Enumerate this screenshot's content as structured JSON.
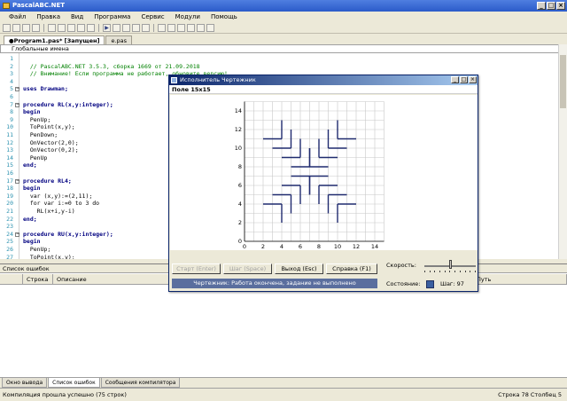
{
  "app": {
    "title": "PascalABC.NET"
  },
  "menu": [
    "Файл",
    "Правка",
    "Вид",
    "Программа",
    "Сервис",
    "Модули",
    "Помощь"
  ],
  "tabs": [
    {
      "label": "●Program1.pas* [Запущен]",
      "active": true
    },
    {
      "label": "e.pas",
      "active": false
    }
  ],
  "scope": {
    "label": "Глобальные имена"
  },
  "editor": {
    "line_numbers": [
      "1",
      "2",
      "3",
      "4",
      "5",
      "6",
      "7",
      "8",
      "9",
      "10",
      "11",
      "12",
      "13",
      "14",
      "15",
      "16",
      "17",
      "18",
      "19",
      "20",
      "21",
      "22",
      "23",
      "24",
      "25",
      "26",
      "27"
    ],
    "lines": [
      {
        "text": "",
        "type": "plain"
      },
      {
        "text": "  // PascalABC.NET 3.5.3, сборка 1669 от 21.09.2018",
        "type": "comment"
      },
      {
        "text": "  // Внимание! Если программа не работает, обновите версию!",
        "type": "comment"
      },
      {
        "text": "",
        "type": "plain"
      },
      {
        "text": "uses Drawman;",
        "type": "kw"
      },
      {
        "text": "",
        "type": "plain"
      },
      {
        "text": "procedure RL(x,y:integer);",
        "type": "kw"
      },
      {
        "text": "begin",
        "type": "kw"
      },
      {
        "text": "  PenUp;",
        "type": "plain"
      },
      {
        "text": "  ToPoint(x,y);",
        "type": "plain"
      },
      {
        "text": "  PenDown;",
        "type": "plain"
      },
      {
        "text": "  OnVector(2,0);",
        "type": "plain"
      },
      {
        "text": "  OnVector(0,2);",
        "type": "plain"
      },
      {
        "text": "  PenUp",
        "type": "plain"
      },
      {
        "text": "end;",
        "type": "kw"
      },
      {
        "text": "",
        "type": "plain"
      },
      {
        "text": "procedure RL4;",
        "type": "kw"
      },
      {
        "text": "begin",
        "type": "kw"
      },
      {
        "text": "  var (x,y):=(2,11);",
        "type": "plain"
      },
      {
        "text": "  for var i:=0 to 3 do",
        "type": "plain"
      },
      {
        "text": "    RL(x+i,y-i)",
        "type": "plain"
      },
      {
        "text": "end;",
        "type": "kw"
      },
      {
        "text": "",
        "type": "plain"
      },
      {
        "text": "procedure RU(x,y:integer);",
        "type": "kw"
      },
      {
        "text": "begin",
        "type": "kw"
      },
      {
        "text": "  PenUp;",
        "type": "plain"
      },
      {
        "text": "  ToPoint(x,y);",
        "type": "plain"
      }
    ]
  },
  "error_panel": {
    "title": "Список ошибок",
    "columns": [
      "",
      "Строка",
      "Описание",
      "Путь"
    ]
  },
  "bottom_tabs": [
    "Окно вывода",
    "Список ошибок",
    "Сообщения компилятора"
  ],
  "status": {
    "left": "Компиляция прошла успешно (75 строк)",
    "right": "Строка 78  Столбец 5"
  },
  "dialog": {
    "title": "Исполнитель Чертежник",
    "field_label": "Поле 15x15",
    "axis_ticks": [
      "0",
      "2",
      "4",
      "6",
      "8",
      "10",
      "12",
      "14"
    ],
    "buttons": {
      "start": "Старт (Enter)",
      "step": "Шаг (Space)",
      "exit": "Выход (Esc)",
      "help": "Справка (F1)"
    },
    "speed_label": "Скорость:",
    "speed_level": 0.5,
    "state_label": "Состояние:",
    "step_label": "Шаг: 97",
    "message": "Чертежник: Работа окончена, задание не выполнено",
    "colors": {
      "stroke": "#1f2a6e",
      "titlebar": "#0a246a",
      "message_bg": "#5a6e9e"
    }
  }
}
